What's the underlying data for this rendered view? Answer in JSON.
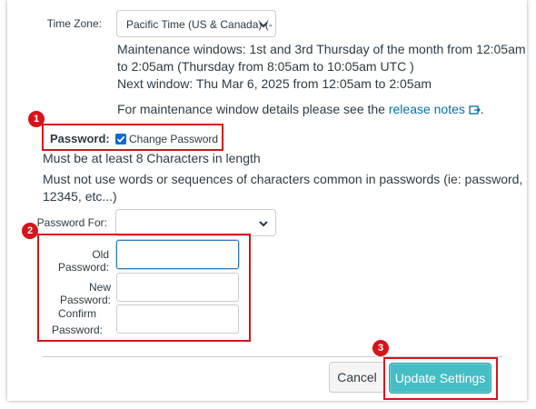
{
  "time_zone": {
    "label": "Time Zone:",
    "selected": "Pacific Time (US & Canada) (-"
  },
  "maintenance": {
    "line1": "Maintenance windows: 1st and 3rd Thursday of the month from 12:05am",
    "line2": "to 2:05am (Thursday from 8:05am to 10:05am UTC )",
    "next_window": "Next window: Thu Mar 6, 2025 from 12:05am to 2:05am",
    "details_prefix": "For maintenance window details please see the",
    "release_notes_link": "release notes",
    "details_suffix": "."
  },
  "password": {
    "label": "Password:",
    "change_checkbox_label": "Change Password",
    "change_checked": true,
    "rule1": "Must be at least 8 Characters in length",
    "rule2_line1": "Must not use words or sequences of characters common in passwords (ie: password,",
    "rule2_line2": "12345, etc...)",
    "password_for_label": "Password For:",
    "password_for_value": "",
    "old_label": "Old Password:",
    "new_label": "New Password:",
    "confirm_label_line1": "Confirm",
    "confirm_label_line2": "Password:"
  },
  "actions": {
    "cancel_label": "Cancel",
    "update_label": "Update Settings"
  },
  "callouts": [
    "1",
    "2",
    "3"
  ],
  "colors": {
    "callout_red": "#d7141a",
    "primary_button": "#44bec4",
    "link": "#0770a3",
    "focus_border": "#2b7abc"
  }
}
